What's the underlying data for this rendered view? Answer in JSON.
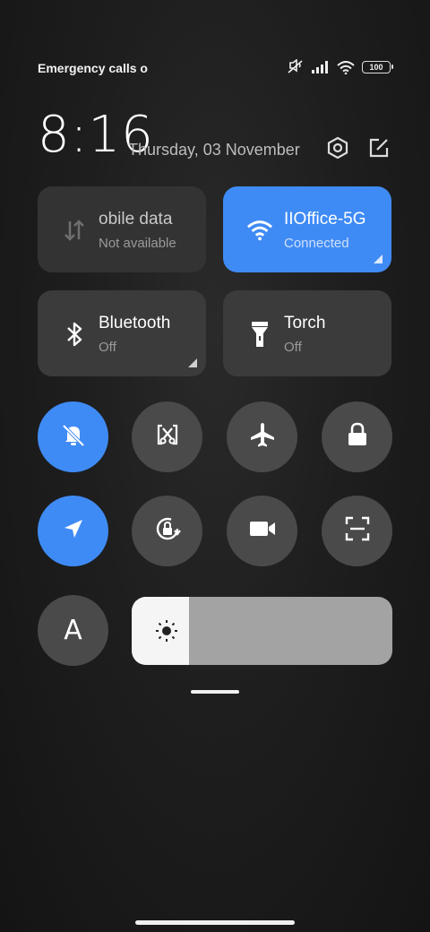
{
  "status_bar": {
    "carrier_text": "Emergency calls o",
    "battery_level": "100",
    "icons": [
      "silent-icon",
      "signal-icon",
      "wifi-icon",
      "battery-icon"
    ]
  },
  "header": {
    "time": "8:16",
    "date": "Thursday, 03 November",
    "icons": [
      "settings-icon",
      "edit-icon"
    ]
  },
  "tiles": [
    {
      "name": "mobile-data",
      "title": "obile data",
      "subtitle": "Not available",
      "icon": "mobile-data-icon",
      "state": "unavailable"
    },
    {
      "name": "wifi",
      "title": "IIOffice-5G",
      "subtitle": "Connected",
      "icon": "wifi-icon",
      "state": "on"
    },
    {
      "name": "bluetooth",
      "title": "Bluetooth",
      "subtitle": "Off",
      "icon": "bluetooth-icon",
      "state": "off"
    },
    {
      "name": "torch",
      "title": "Torch",
      "subtitle": "Off",
      "icon": "torch-icon",
      "state": "off"
    }
  ],
  "toggles": [
    {
      "name": "silent",
      "icon": "bell-off-icon",
      "on": true
    },
    {
      "name": "screenshot",
      "icon": "screenshot-icon",
      "on": false
    },
    {
      "name": "airplane-mode",
      "icon": "airplane-icon",
      "on": false
    },
    {
      "name": "lock-screen",
      "icon": "lock-icon",
      "on": false
    },
    {
      "name": "location",
      "icon": "location-arrow-icon",
      "on": true
    },
    {
      "name": "rotation-lock",
      "icon": "rotation-lock-icon",
      "on": false
    },
    {
      "name": "screen-recorder",
      "icon": "video-camera-icon",
      "on": false
    },
    {
      "name": "scanner",
      "icon": "scan-icon",
      "on": false
    }
  ],
  "auto_brightness": {
    "label": "A"
  },
  "brightness": {
    "level_percent": 22,
    "icon": "sun-icon"
  },
  "colors": {
    "accent": "#3f8bf5",
    "tile": "#3b3b3b",
    "round_button": "#4a4a4a",
    "slider_track": "#a3a3a3",
    "slider_fill": "#f5f5f5"
  }
}
